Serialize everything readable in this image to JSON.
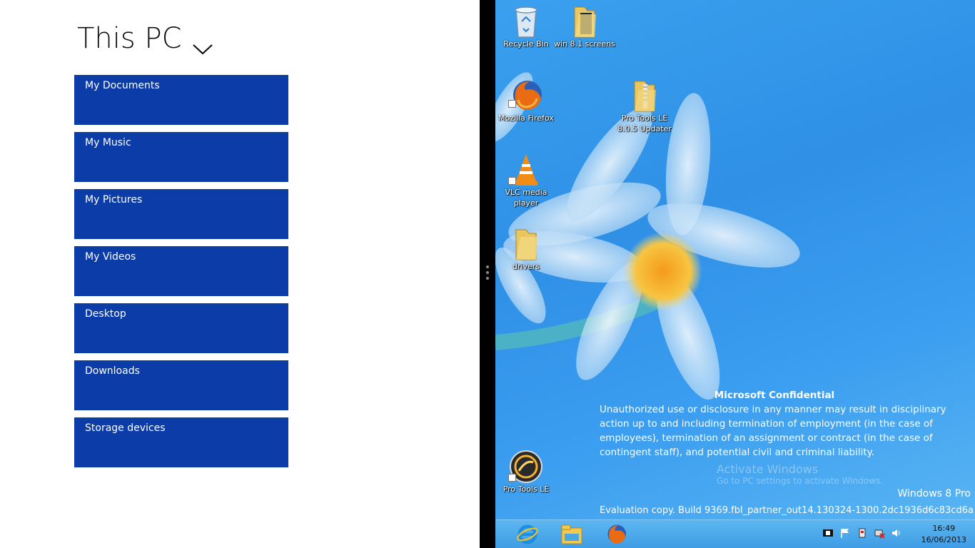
{
  "app": {
    "title": "This PC",
    "tiles": [
      {
        "label": "My Documents"
      },
      {
        "label": "My Music"
      },
      {
        "label": "My Pictures"
      },
      {
        "label": "My Videos"
      },
      {
        "label": "Desktop"
      },
      {
        "label": "Downloads"
      },
      {
        "label": "Storage devices"
      }
    ],
    "tile_color": "#0b3ca8"
  },
  "desktop": {
    "icons": {
      "recycle_bin": {
        "label": "Recycle Bin",
        "icon": "recycle-bin-icon"
      },
      "win81": {
        "label": "win 8.1 screens",
        "icon": "folder-icon"
      },
      "firefox": {
        "label": "Mozilla Firefox",
        "icon": "firefox-icon"
      },
      "protools_updater": {
        "label": "Pro Tools LE 8.0.5 Updater",
        "icon": "zip-folder-icon"
      },
      "vlc": {
        "label": "VLC media player",
        "icon": "vlc-icon"
      },
      "drivers": {
        "label": "drivers",
        "icon": "folder-icon"
      },
      "protools": {
        "label": "Pro Tools LE",
        "icon": "protools-icon"
      }
    },
    "confidential": {
      "heading": "Microsoft Confidential",
      "body": "Unauthorized use or disclosure in any manner may result in disciplinary action up to and including termination of employment (in the case of employees), termination of an assignment or contract (in the case of contingent staff), and potential civil and criminal liability."
    },
    "activate": {
      "title": "Activate Windows",
      "subtitle": "Go to PC settings to activate Windows."
    },
    "edition": "Windows 8 Pro",
    "build": "Evaluation copy. Build 9369.fbl_partner_out14.130324-1300.2dc1936d6c83cd6a"
  },
  "taskbar": {
    "pinned": [
      "internet-explorer-icon",
      "file-explorer-icon",
      "firefox-icon"
    ],
    "clock": {
      "time": "16:49",
      "date": "16/06/2013"
    }
  }
}
